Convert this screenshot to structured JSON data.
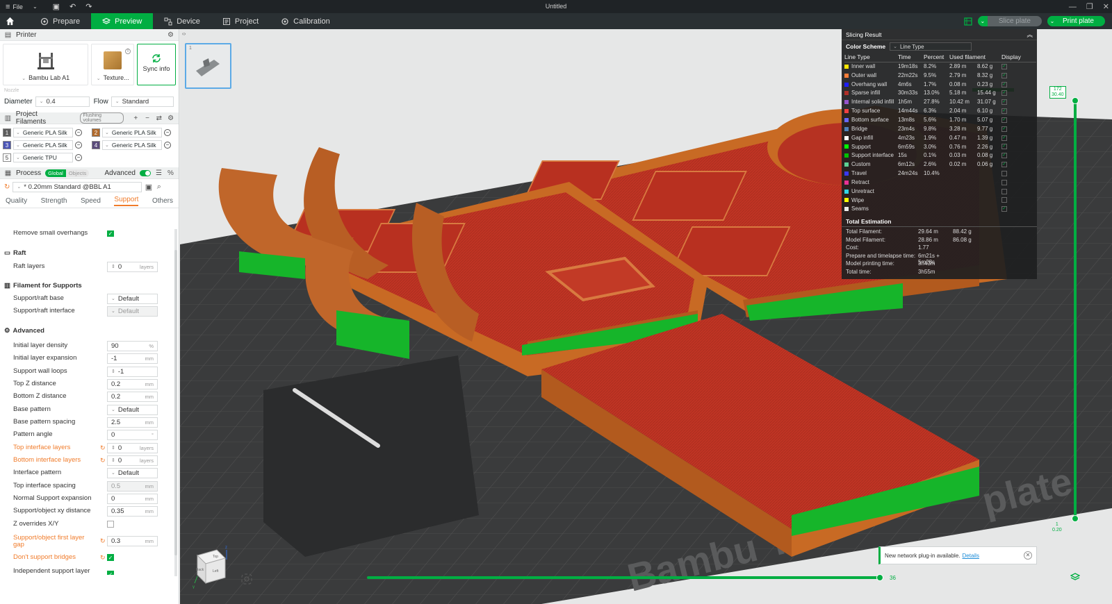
{
  "titlebar": {
    "menu_label": "File",
    "window_title": "Untitled"
  },
  "topbar": {
    "tabs": [
      {
        "label": "Prepare",
        "icon": "prepare-icon"
      },
      {
        "label": "Preview",
        "icon": "preview-icon",
        "active": true
      },
      {
        "label": "Device",
        "icon": "device-icon"
      },
      {
        "label": "Project",
        "icon": "project-icon"
      },
      {
        "label": "Calibration",
        "icon": "calibration-icon"
      }
    ],
    "slice_label": "Slice plate",
    "print_label": "Print plate"
  },
  "printer": {
    "section_title": "Printer",
    "printer_name": "Bambu Lab A1",
    "plate_name": "Texture...",
    "sync_label": "Sync info",
    "nozzle_label": "Nozzle",
    "diameter_label": "Diameter",
    "diameter_value": "0.4",
    "flow_label": "Flow",
    "flow_value": "Standard"
  },
  "filaments": {
    "section_title": "Project Filaments",
    "flushing_label": "Flushing volumes",
    "items": [
      {
        "num": "1",
        "name": "Generic PLA Silk",
        "color": "#5c5c5c"
      },
      {
        "num": "2",
        "name": "Generic PLA Silk",
        "color": "#b06a2c"
      },
      {
        "num": "3",
        "name": "Generic PLA Silk",
        "color": "#4b55b5"
      },
      {
        "num": "4",
        "name": "Generic PLA Silk",
        "color": "#5a4b7a"
      },
      {
        "num": "5",
        "name": "Generic TPU",
        "color": "#ffffff"
      }
    ]
  },
  "process": {
    "section_title": "Process",
    "global_label": "Global",
    "objects_label": "Objects",
    "advanced_label": "Advanced",
    "preset": "* 0.20mm Standard @BBL A1",
    "tabs": [
      "Quality",
      "Strength",
      "Speed",
      "Support",
      "Others"
    ],
    "active_tab": "Support"
  },
  "settings": {
    "cut_label": "Remove small overhangs",
    "raft_group": "Raft",
    "raft_layers_label": "Raft layers",
    "raft_layers_value": "0",
    "filament_group": "Filament for Supports",
    "support_base_label": "Support/raft base",
    "support_base_value": "Default",
    "support_interface_label": "Support/raft interface",
    "support_interface_value": "Default",
    "advanced_group": "Advanced",
    "rows": {
      "initial_density": {
        "label": "Initial layer density",
        "value": "90",
        "unit": "%"
      },
      "initial_expansion": {
        "label": "Initial layer expansion",
        "value": "-1",
        "unit": "mm"
      },
      "wall_loops": {
        "label": "Support wall loops",
        "value": "-1"
      },
      "top_z": {
        "label": "Top Z distance",
        "value": "0.2",
        "unit": "mm"
      },
      "bottom_z": {
        "label": "Bottom Z distance",
        "value": "0.2",
        "unit": "mm"
      },
      "base_pattern": {
        "label": "Base pattern",
        "value": "Default"
      },
      "base_spacing": {
        "label": "Base pattern spacing",
        "value": "2.5",
        "unit": "mm"
      },
      "pattern_angle": {
        "label": "Pattern angle",
        "value": "0",
        "unit": "°"
      },
      "top_interface": {
        "label": "Top interface layers",
        "value": "0",
        "unit": "layers"
      },
      "bottom_interface": {
        "label": "Bottom interface layers",
        "value": "0",
        "unit": "layers"
      },
      "interface_pattern": {
        "label": "Interface pattern",
        "value": "Default"
      },
      "top_interface_spacing": {
        "label": "Top interface spacing",
        "value": "0.5",
        "unit": "mm"
      },
      "normal_expansion": {
        "label": "Normal Support expansion",
        "value": "0",
        "unit": "mm"
      },
      "xy_distance": {
        "label": "Support/object xy distance",
        "value": "0.35",
        "unit": "mm"
      },
      "z_overrides": {
        "label": "Z overrides X/Y"
      },
      "first_layer_gap": {
        "label": "Support/object first layer gap",
        "value": "0.3",
        "unit": "mm"
      },
      "dont_support_bridges": {
        "label": "Don't support bridges"
      },
      "independent_height": {
        "label": "Independent support layer height"
      }
    }
  },
  "slicing": {
    "title": "Slicing Result",
    "color_scheme_label": "Color Scheme",
    "color_scheme_value": "Line Type",
    "headers": [
      "Line Type",
      "Time",
      "Percent",
      "Used filament",
      "Display"
    ],
    "rows": [
      {
        "type": "Inner wall",
        "color": "#ffe600",
        "time": "19m18s",
        "percent": "8.2%",
        "len": "2.89 m",
        "weight": "8.62 g",
        "display": true
      },
      {
        "type": "Outer wall",
        "color": "#ff7d38",
        "time": "22m22s",
        "percent": "9.5%",
        "len": "2.79 m",
        "weight": "8.32 g",
        "display": true
      },
      {
        "type": "Overhang wall",
        "color": "#1f1fff",
        "time": "4m6s",
        "percent": "1.7%",
        "len": "0.08 m",
        "weight": "0.23 g",
        "display": true
      },
      {
        "type": "Sparse infill",
        "color": "#b03029",
        "time": "30m33s",
        "percent": "13.0%",
        "len": "5.18 m",
        "weight": "15.44 g",
        "display": true
      },
      {
        "type": "Internal solid infill",
        "color": "#9654cc",
        "time": "1h5m",
        "percent": "27.8%",
        "len": "10.42 m",
        "weight": "31.07 g",
        "display": true
      },
      {
        "type": "Top surface",
        "color": "#f04040",
        "time": "14m44s",
        "percent": "6.3%",
        "len": "2.04 m",
        "weight": "6.10 g",
        "display": true
      },
      {
        "type": "Bottom surface",
        "color": "#6666ff",
        "time": "13m8s",
        "percent": "5.6%",
        "len": "1.70 m",
        "weight": "5.07 g",
        "display": true
      },
      {
        "type": "Bridge",
        "color": "#4d80ba",
        "time": "23m4s",
        "percent": "9.8%",
        "len": "3.28 m",
        "weight": "9.77 g",
        "display": true
      },
      {
        "type": "Gap infill",
        "color": "#ffffff",
        "time": "4m23s",
        "percent": "1.9%",
        "len": "0.47 m",
        "weight": "1.39 g",
        "display": true
      },
      {
        "type": "Support",
        "color": "#00ff00",
        "time": "6m59s",
        "percent": "3.0%",
        "len": "0.76 m",
        "weight": "2.26 g",
        "display": true
      },
      {
        "type": "Support interface",
        "color": "#00c000",
        "time": "15s",
        "percent": "0.1%",
        "len": "0.03 m",
        "weight": "0.08 g",
        "display": true
      },
      {
        "type": "Custom",
        "color": "#5ed194",
        "time": "6m12s",
        "percent": "2.6%",
        "len": "0.02 m",
        "weight": "0.06 g",
        "display": true
      },
      {
        "type": "Travel",
        "color": "#3838f2",
        "time": "24m24s",
        "percent": "10.4%",
        "len": "",
        "weight": "",
        "display": false
      },
      {
        "type": "Retract",
        "color": "#e63294",
        "time": "",
        "percent": "",
        "len": "",
        "weight": "",
        "display": false
      },
      {
        "type": "Unretract",
        "color": "#32d4e6",
        "time": "",
        "percent": "",
        "len": "",
        "weight": "",
        "display": false
      },
      {
        "type": "Wipe",
        "color": "#ffff00",
        "time": "",
        "percent": "",
        "len": "",
        "weight": "",
        "display": false
      },
      {
        "type": "Seams",
        "color": "#ececec",
        "time": "",
        "percent": "",
        "len": "",
        "weight": "",
        "display": true
      }
    ],
    "total_title": "Total Estimation",
    "totals": [
      {
        "k": "Total Filament:",
        "v1": "29.64 m",
        "v2": "88.42 g"
      },
      {
        "k": "Model Filament:",
        "v1": "28.86 m",
        "v2": "86.08 g"
      },
      {
        "k": "Cost:",
        "v1": "1.77",
        "v2": ""
      },
      {
        "k": "Prepare and timelapse time:",
        "v1": "6m21s + 5m28s",
        "v2": ""
      },
      {
        "k": "Model printing time:",
        "v1": "3h43m",
        "v2": ""
      },
      {
        "k": "Total time:",
        "v1": "3h55m",
        "v2": ""
      }
    ]
  },
  "layers": {
    "top_layer": "172",
    "top_height": "30.40",
    "bottom_layer": "1",
    "bottom_height": "0.20",
    "move_value": "36"
  },
  "plate": {
    "thumb_number": "1",
    "bed_text_1": "Bambu T",
    "bed_text_2": "plate"
  },
  "cube": {
    "top": "Top",
    "left": "Left",
    "back": "Back",
    "z": "z",
    "y": "y"
  },
  "notification": {
    "text": "New network plug-in available.",
    "link": "Details"
  },
  "colors": {
    "accent": "#00ae42",
    "modified": "#f07b2a",
    "model_red": "#c03424",
    "model_orange": "#c86a24"
  }
}
